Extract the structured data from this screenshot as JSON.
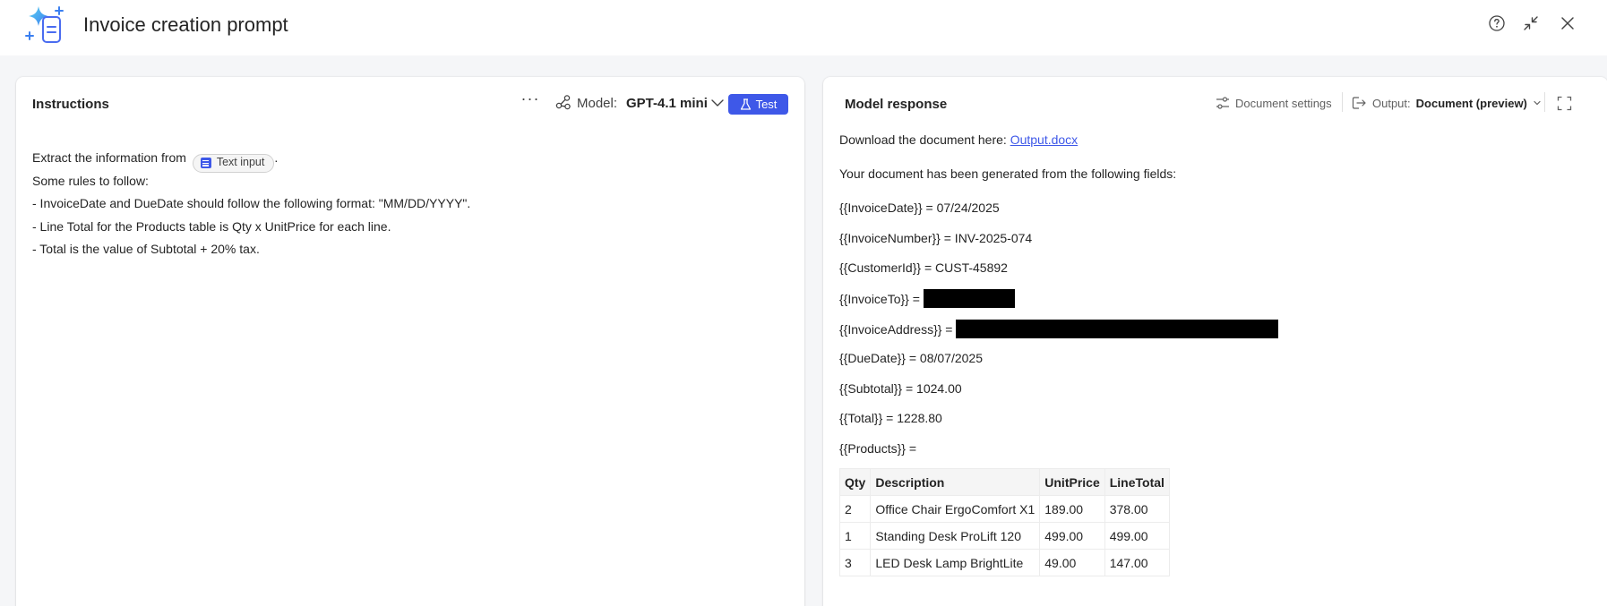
{
  "app": {
    "title": "Invoice creation prompt",
    "accent": "#3e58e8"
  },
  "header_actions": {
    "help_icon": "help-circle-icon",
    "collapse_icon": "collapse-arrows-icon",
    "close_icon": "close-icon"
  },
  "instructions_panel": {
    "title": "Instructions",
    "more_label": "···",
    "model_label": "Model:",
    "model_value": "GPT-4.1 mini",
    "test_label": "Test",
    "text": {
      "line1_prefix": "Extract the information from",
      "input_pill": "Text input",
      "line1_suffix": ".",
      "line2": "Some rules to follow:",
      "line3": "- InvoiceDate and DueDate should follow the following format: \"MM/DD/YYYY\".",
      "line4": "- Line Total for the Products table is Qty x UnitPrice for each line.",
      "line5": "- Total is the value of Subtotal + 20% tax."
    }
  },
  "response_panel": {
    "title": "Model response",
    "document_settings_label": "Document settings",
    "output_label": "Output:",
    "output_value": "Document (preview)",
    "download_prefix": "Download the document here:",
    "download_link": "Output.docx",
    "generated_text": "Your document has been generated from the following fields:",
    "fields": {
      "invoice_date": "{{InvoiceDate}} = 07/24/2025",
      "invoice_number": "{{InvoiceNumber}} = INV-2025-074",
      "customer_id": "{{CustomerId}} = CUST-45892",
      "invoice_to": "{{InvoiceTo}} =",
      "invoice_address": "{{InvoiceAddress}} =",
      "due_date": "{{DueDate}} = 08/07/2025",
      "subtotal": "{{Subtotal}} = 1024.00",
      "total": "{{Total}} = 1228.80",
      "products": "{{Products}} ="
    },
    "table": {
      "headers": [
        "Qty",
        "Description",
        "UnitPrice",
        "LineTotal"
      ],
      "rows": [
        [
          "2",
          "Office Chair ErgoComfort X1",
          "189.00",
          "378.00"
        ],
        [
          "1",
          "Standing Desk ProLift 120",
          "499.00",
          "499.00"
        ],
        [
          "3",
          "LED Desk Lamp BrightLite",
          "49.00",
          "147.00"
        ]
      ]
    }
  }
}
